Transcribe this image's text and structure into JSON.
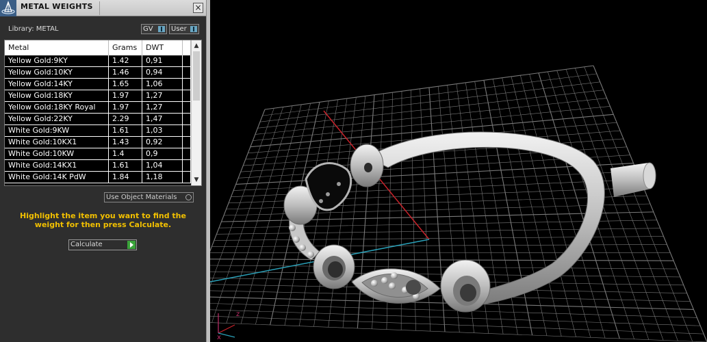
{
  "panel": {
    "title": "METAL WEIGHTS",
    "close_label": "×",
    "library_label": "Library: METAL",
    "buttons": {
      "gv": "GV",
      "user": "User"
    },
    "use_object_materials": "Use Object Materials",
    "hint": "Highlight the item you want to find the weight for then press Calculate.",
    "calculate_label": "Calculate"
  },
  "table": {
    "columns": [
      "Metal",
      "Grams",
      "DWT"
    ],
    "rows": [
      {
        "metal": "Yellow Gold:9KY",
        "grams": "1.42",
        "dwt": "0,91"
      },
      {
        "metal": "Yellow Gold:10KY",
        "grams": "1.46",
        "dwt": "0,94"
      },
      {
        "metal": "Yellow Gold:14KY",
        "grams": "1.65",
        "dwt": "1,06"
      },
      {
        "metal": "Yellow Gold:18KY",
        "grams": "1.97",
        "dwt": "1,27"
      },
      {
        "metal": "Yellow Gold:18KY Royal",
        "grams": "1.97",
        "dwt": "1,27"
      },
      {
        "metal": "Yellow Gold:22KY",
        "grams": "2.29",
        "dwt": "1,47"
      },
      {
        "metal": "White Gold:9KW",
        "grams": "1.61",
        "dwt": "1,03"
      },
      {
        "metal": "White Gold:10KX1",
        "grams": "1.43",
        "dwt": "0,92"
      },
      {
        "metal": "White Gold:10KW",
        "grams": "1.4",
        "dwt": "0,9"
      },
      {
        "metal": "White Gold:14KX1",
        "grams": "1.61",
        "dwt": "1,04"
      },
      {
        "metal": "White Gold:14K PdW",
        "grams": "1.84",
        "dwt": "1,18"
      }
    ]
  },
  "viewport": {
    "axis_labels": {
      "x": "x",
      "z": "z"
    }
  },
  "colors": {
    "panel_bg": "#2e2e2e",
    "hint_text": "#f2c000",
    "axis_red": "#c8232b",
    "axis_cyan": "#2aa0b8",
    "grid": "#7a7a7a"
  }
}
